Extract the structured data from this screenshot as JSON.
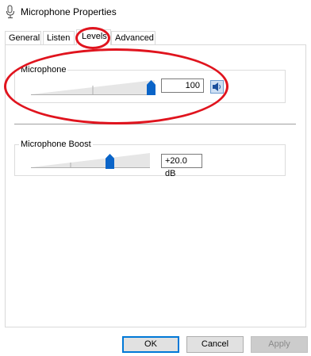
{
  "window": {
    "title": "Microphone Properties"
  },
  "tabs": [
    {
      "label": "General"
    },
    {
      "label": "Listen"
    },
    {
      "label": "Levels"
    },
    {
      "label": "Advanced"
    }
  ],
  "levels": {
    "microphone": {
      "label": "Microphone",
      "value": "100",
      "level_percent": 100
    },
    "boost": {
      "label": "Microphone Boost",
      "value": "+20.0 dB",
      "level_fraction": 0.66
    }
  },
  "buttons": {
    "ok": "OK",
    "cancel": "Cancel",
    "apply": "Apply"
  },
  "colors": {
    "accent": "#0078d7",
    "annotation": "#e0141e"
  },
  "icons": {
    "title": "microphone-icon",
    "mute": "speaker-icon"
  }
}
